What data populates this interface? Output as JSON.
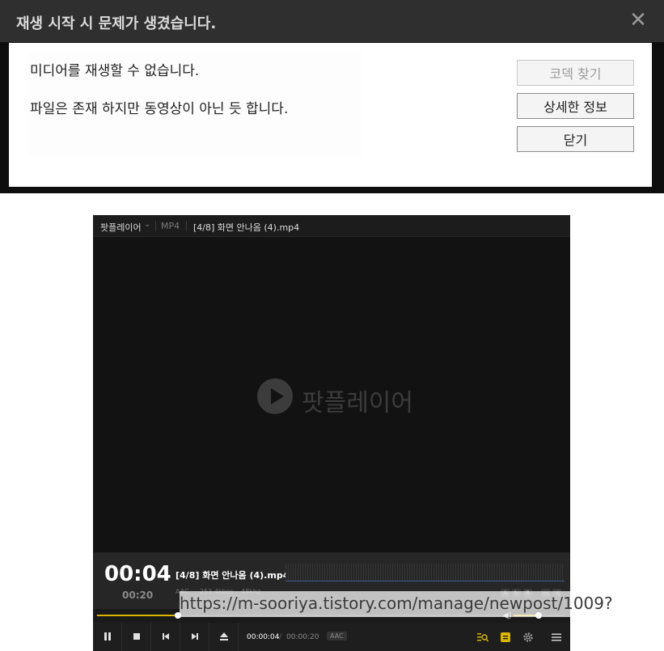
{
  "dialog": {
    "title": "재생 시작 시 문제가 생겼습니다.",
    "close_symbol": "✕",
    "message1": "미디어를 재생할 수 없습니다.",
    "message2": "파일은 존재 하지만 동영상이 아닌 듯 합니다.",
    "btn_codec": "코덱 찾기",
    "btn_details": "상세한 정보",
    "btn_close": "닫기"
  },
  "player": {
    "app_menu": "팟플레이어",
    "app_menu_chevron": "⌄",
    "format": "MP4",
    "file_title": "[4/8] 화면 안나옴 (4).mp4",
    "watermark": "팟플레이어",
    "current_time_big": "00:04",
    "total_time_small": "00:20",
    "info_filename": "[4/8] 화면 안나옴 (4).mp4",
    "audio_codec": "AAC",
    "bitrate": "253.4kbps",
    "samplerate": "48khz",
    "mini_icons": [
      "A",
      "↻",
      "B",
      "▭",
      "⤨"
    ],
    "seek_fraction": 0.2,
    "volume_fraction": 0.5,
    "time_current": "00:00:04",
    "time_slash": "/",
    "time_total": "00:00:20",
    "audio_badge": "AAC",
    "accent_color": "#d9b400"
  },
  "overlay_url": "https://m-sooriya.tistory.com/manage/newpost/1009?"
}
